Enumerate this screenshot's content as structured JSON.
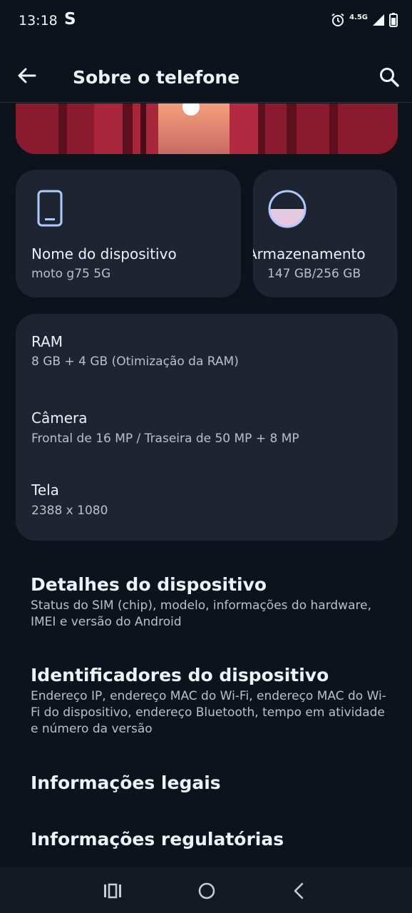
{
  "status_bar": {
    "time": "13:18",
    "carrier_icon_glyph": "S",
    "network": "4.5G",
    "icons": [
      "alarm-icon",
      "signal-icon",
      "battery-icon"
    ]
  },
  "app_bar": {
    "title": "Sobre o telefone",
    "back_icon": "arrow-left-icon",
    "search_icon": "search-icon"
  },
  "cards": {
    "device": {
      "label": "Nome do dispositivo",
      "value": "moto g75 5G",
      "icon": "phone-icon"
    },
    "storage": {
      "label": "Armazenamento",
      "value": "147 GB/256 GB",
      "icon": "storage-pie-icon"
    }
  },
  "specs": [
    {
      "label": "RAM",
      "value": "8 GB + 4 GB (Otimização da RAM)"
    },
    {
      "label": "Câmera",
      "value": "Frontal de 16 MP / Traseira de 50 MP + 8 MP"
    },
    {
      "label": "Tela",
      "value": "2388 x 1080"
    }
  ],
  "list": [
    {
      "title": "Detalhes do dispositivo",
      "subtitle": "Status do SIM (chip), modelo, informações do hardware, IMEI e versão do Android"
    },
    {
      "title": "Identificadores do dispositivo",
      "subtitle": "Endereço IP, endereço MAC do Wi-Fi, endereço MAC do Wi-Fi do dispositivo, endereço Bluetooth, tempo em atividade e número da versão"
    },
    {
      "title": "Informações legais",
      "subtitle": ""
    },
    {
      "title": "Informações regulatórias",
      "subtitle": ""
    }
  ],
  "nav": [
    "recents-icon",
    "home-icon",
    "back-icon"
  ],
  "colors": {
    "background": "#0d131b",
    "card": "#1e2530",
    "accent": "#aecbff",
    "hero": "#941f33"
  }
}
